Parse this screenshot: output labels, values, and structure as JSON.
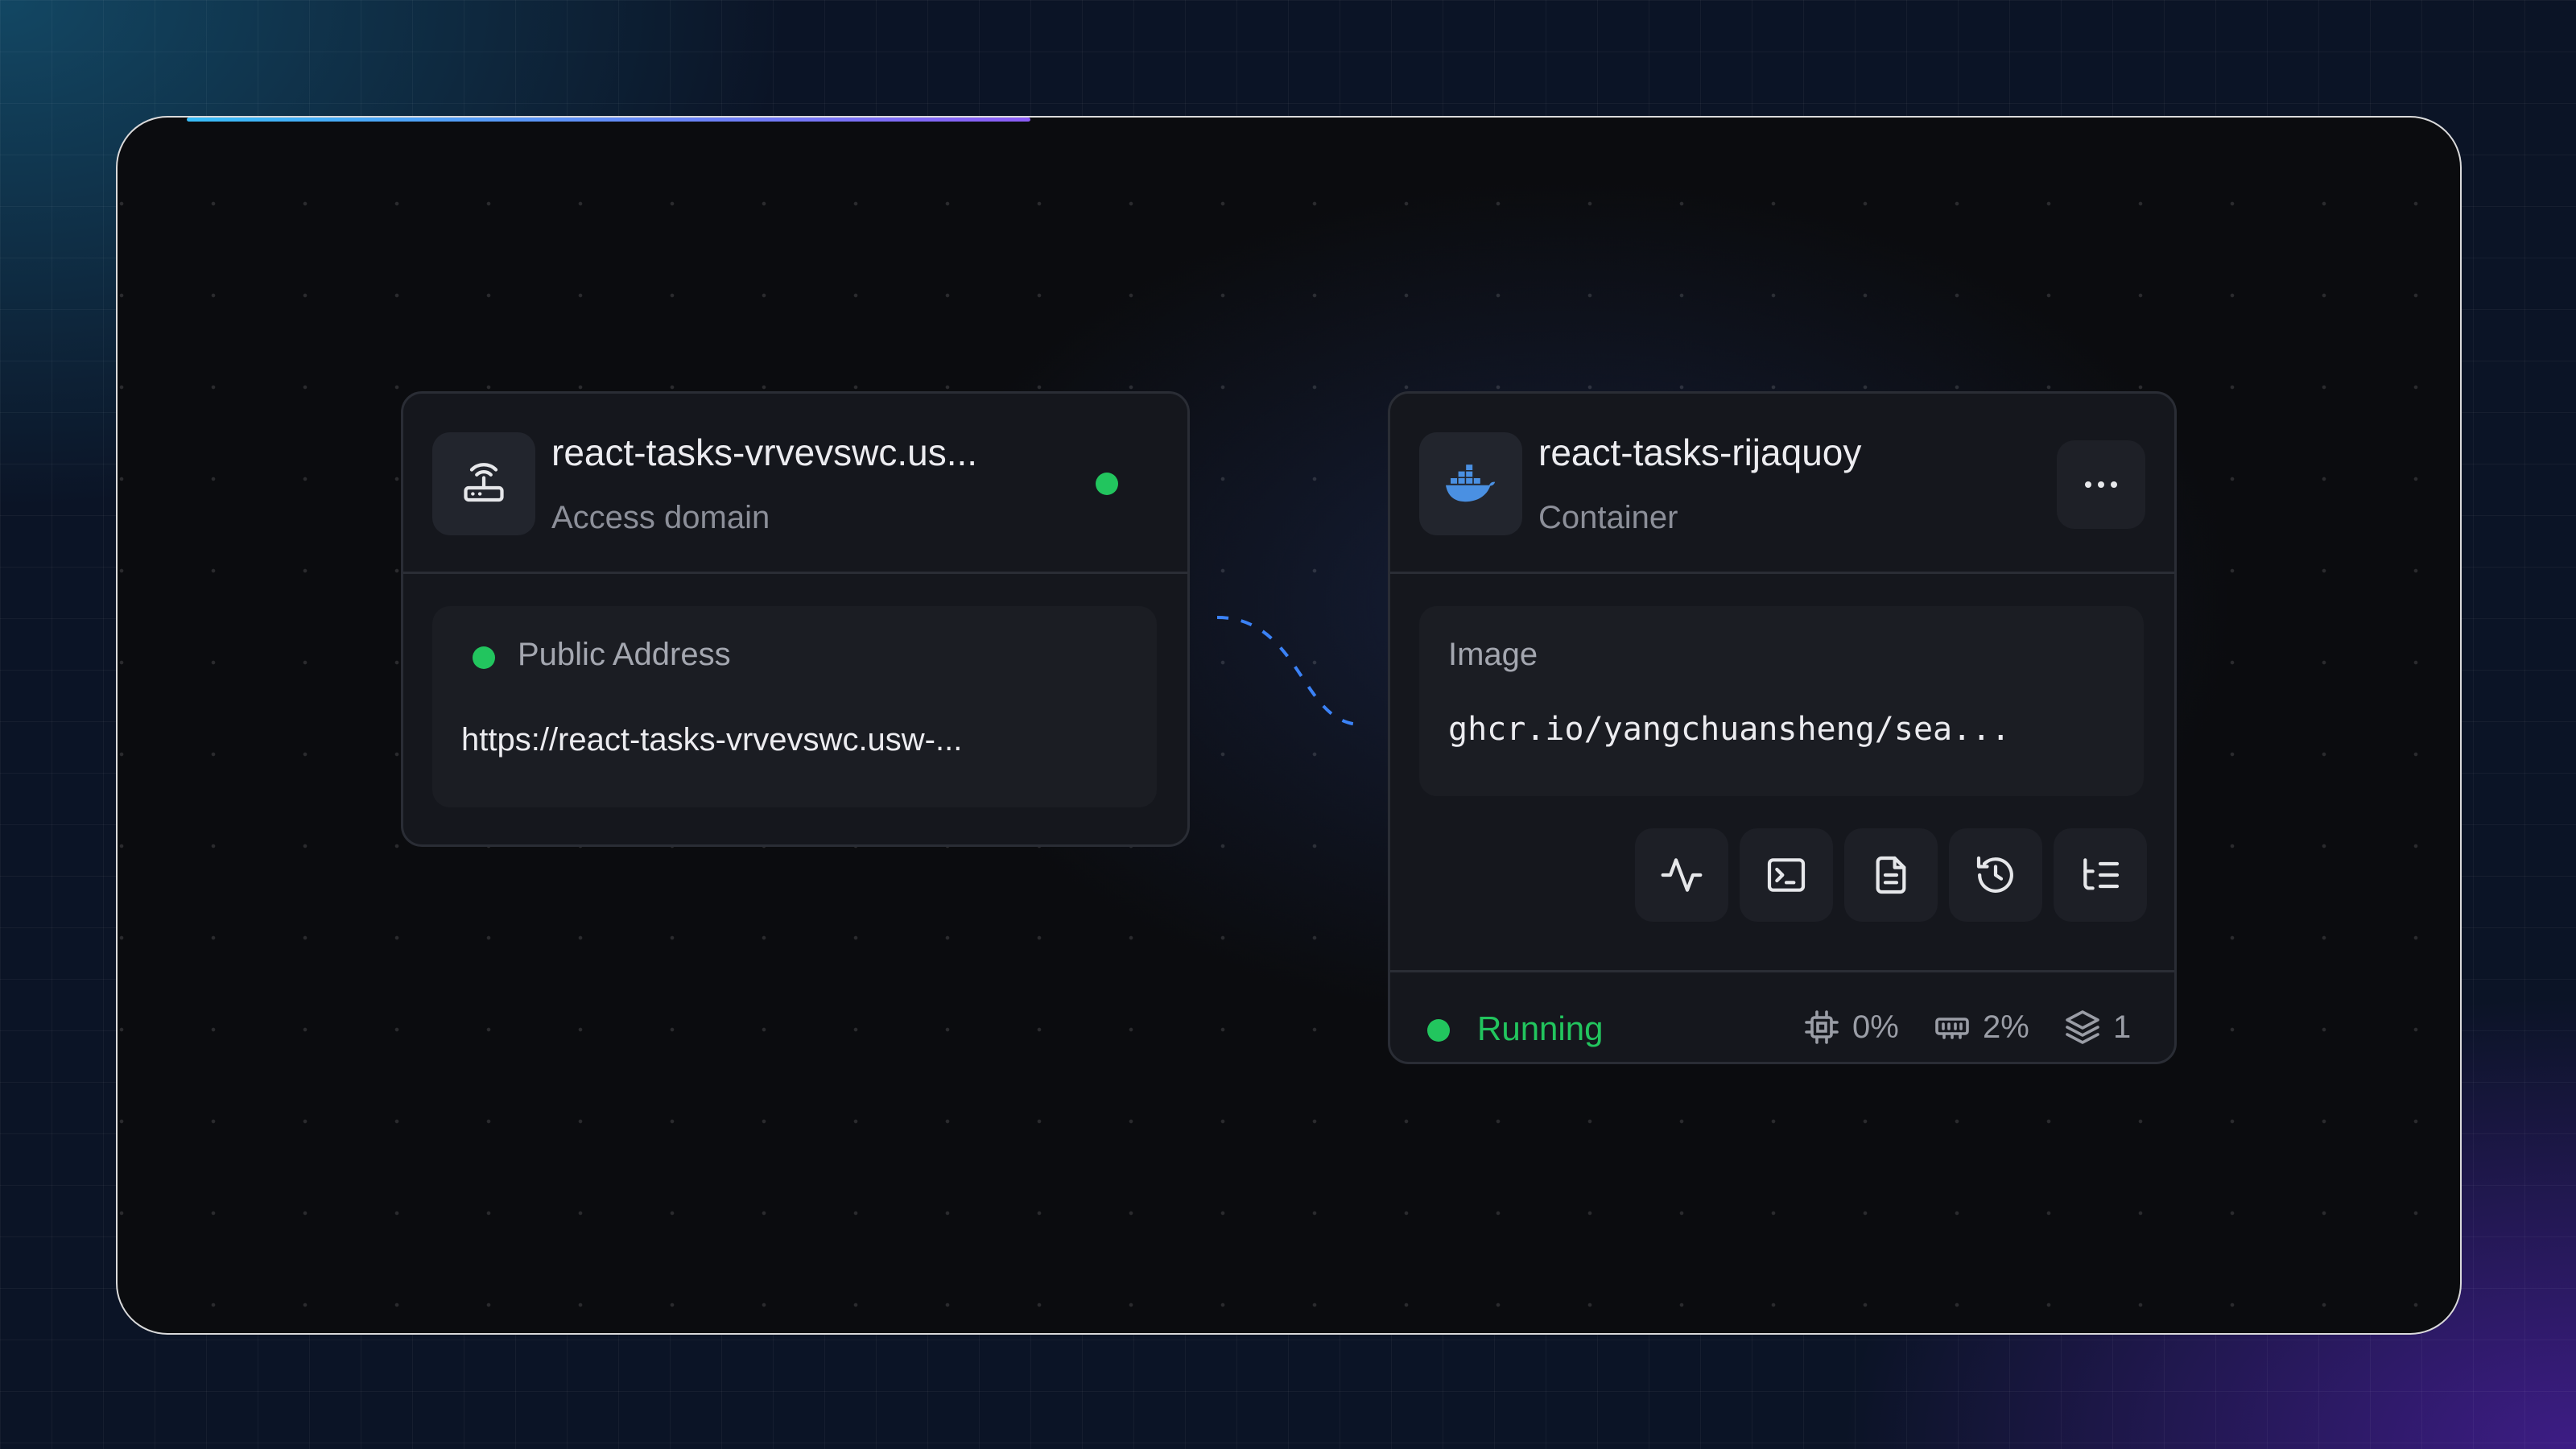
{
  "access_node": {
    "title": "react-tasks-vrvevswc.us...",
    "subtitle": "Access domain",
    "icon": "router-icon",
    "status_color": "#22c55e",
    "public_address_label": "Public Address",
    "url": "https://react-tasks-vrvevswc.usw-..."
  },
  "container_node": {
    "title": "react-tasks-rijaquoy",
    "subtitle": "Container",
    "icon": "docker-icon",
    "image_label": "Image",
    "image_value": "ghcr.io/yangchuansheng/sea...",
    "actions": [
      "activity-icon",
      "terminal-icon",
      "logs-icon",
      "history-icon",
      "list-tree-icon"
    ],
    "status_label": "Running",
    "status_color": "#22c55e",
    "cpu": "0%",
    "memory": "2%",
    "replicas": "1"
  },
  "progress": {
    "value": 0.36
  },
  "colors": {
    "accent_start": "#38bdf8",
    "accent_end": "#8b5cf6",
    "edge": "#3b82f6",
    "docker": "#4a90e2"
  }
}
